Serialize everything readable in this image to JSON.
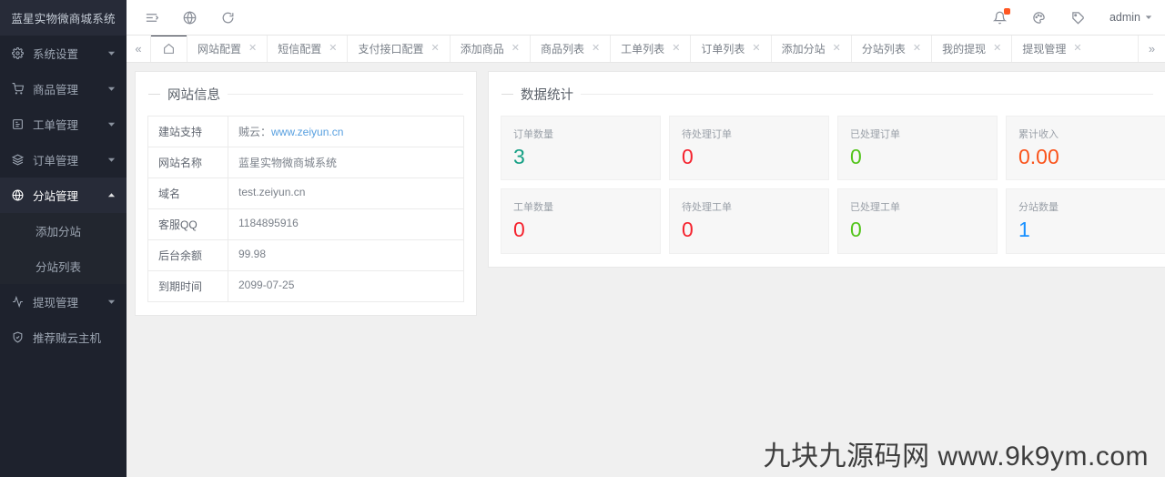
{
  "sidebar": {
    "logo": "蓝星实物微商城系统",
    "items": [
      {
        "label": "系统设置",
        "icon": "gear-icon",
        "expandable": true,
        "active": false
      },
      {
        "label": "商品管理",
        "icon": "cart-icon",
        "expandable": true,
        "active": false
      },
      {
        "label": "工单管理",
        "icon": "form-icon",
        "expandable": true,
        "active": false
      },
      {
        "label": "订单管理",
        "icon": "layers-icon",
        "expandable": true,
        "active": false
      },
      {
        "label": "分站管理",
        "icon": "globe-icon",
        "expandable": true,
        "active": true
      },
      {
        "label": "提现管理",
        "icon": "activity-icon",
        "expandable": true,
        "active": false
      },
      {
        "label": "推荐贼云主机",
        "icon": "shield-check-icon",
        "expandable": false,
        "active": false
      }
    ],
    "submenu": [
      {
        "label": "添加分站"
      },
      {
        "label": "分站列表"
      }
    ]
  },
  "header": {
    "left_icons": [
      "menu-collapse-icon",
      "globe-icon",
      "refresh-icon"
    ],
    "right_icons": [
      "bell-icon",
      "palette-icon",
      "tag-icon"
    ],
    "user_label": "admin"
  },
  "tabs": {
    "collapse_left_label": "«",
    "expand_right_label": "»",
    "home_label": "home-icon",
    "items": [
      {
        "label": "网站配置",
        "closable": true
      },
      {
        "label": "短信配置",
        "closable": true
      },
      {
        "label": "支付接口配置",
        "closable": true
      },
      {
        "label": "添加商品",
        "closable": true
      },
      {
        "label": "商品列表",
        "closable": true
      },
      {
        "label": "工单列表",
        "closable": true
      },
      {
        "label": "订单列表",
        "closable": true
      },
      {
        "label": "添加分站",
        "closable": true
      },
      {
        "label": "分站列表",
        "closable": true
      },
      {
        "label": "我的提现",
        "closable": true
      },
      {
        "label": "提现管理",
        "closable": true
      }
    ],
    "close_label": "✕"
  },
  "site_info": {
    "title": "网站信息",
    "rows": [
      {
        "key": "建站支持",
        "value_prefix": "贼云：",
        "link": "www.zeiyun.cn"
      },
      {
        "key": "网站名称",
        "value": "蓝星实物微商城系统"
      },
      {
        "key": "域名",
        "value": "test.zeiyun.cn"
      },
      {
        "key": "客服QQ",
        "value": "1184895916"
      },
      {
        "key": "后台余额",
        "value": "99.98"
      },
      {
        "key": "到期时间",
        "value": "2099-07-25"
      }
    ]
  },
  "statistics": {
    "title": "数据统计",
    "cards": [
      {
        "label": "订单数量",
        "value": "3",
        "color": "#16a085"
      },
      {
        "label": "待处理订单",
        "value": "0",
        "color": "#f5222d"
      },
      {
        "label": "已处理订单",
        "value": "0",
        "color": "#52c41a"
      },
      {
        "label": "累计收入",
        "value": "0.00",
        "color": "#fa541c"
      },
      {
        "label": "工单数量",
        "value": "0",
        "color": "#f5222d"
      },
      {
        "label": "待处理工单",
        "value": "0",
        "color": "#f5222d"
      },
      {
        "label": "已处理工单",
        "value": "0",
        "color": "#52c41a"
      },
      {
        "label": "分站数量",
        "value": "1",
        "color": "#1890ff"
      }
    ]
  },
  "watermark": {
    "text": "九块九源码网 www.9k9ym.com"
  }
}
